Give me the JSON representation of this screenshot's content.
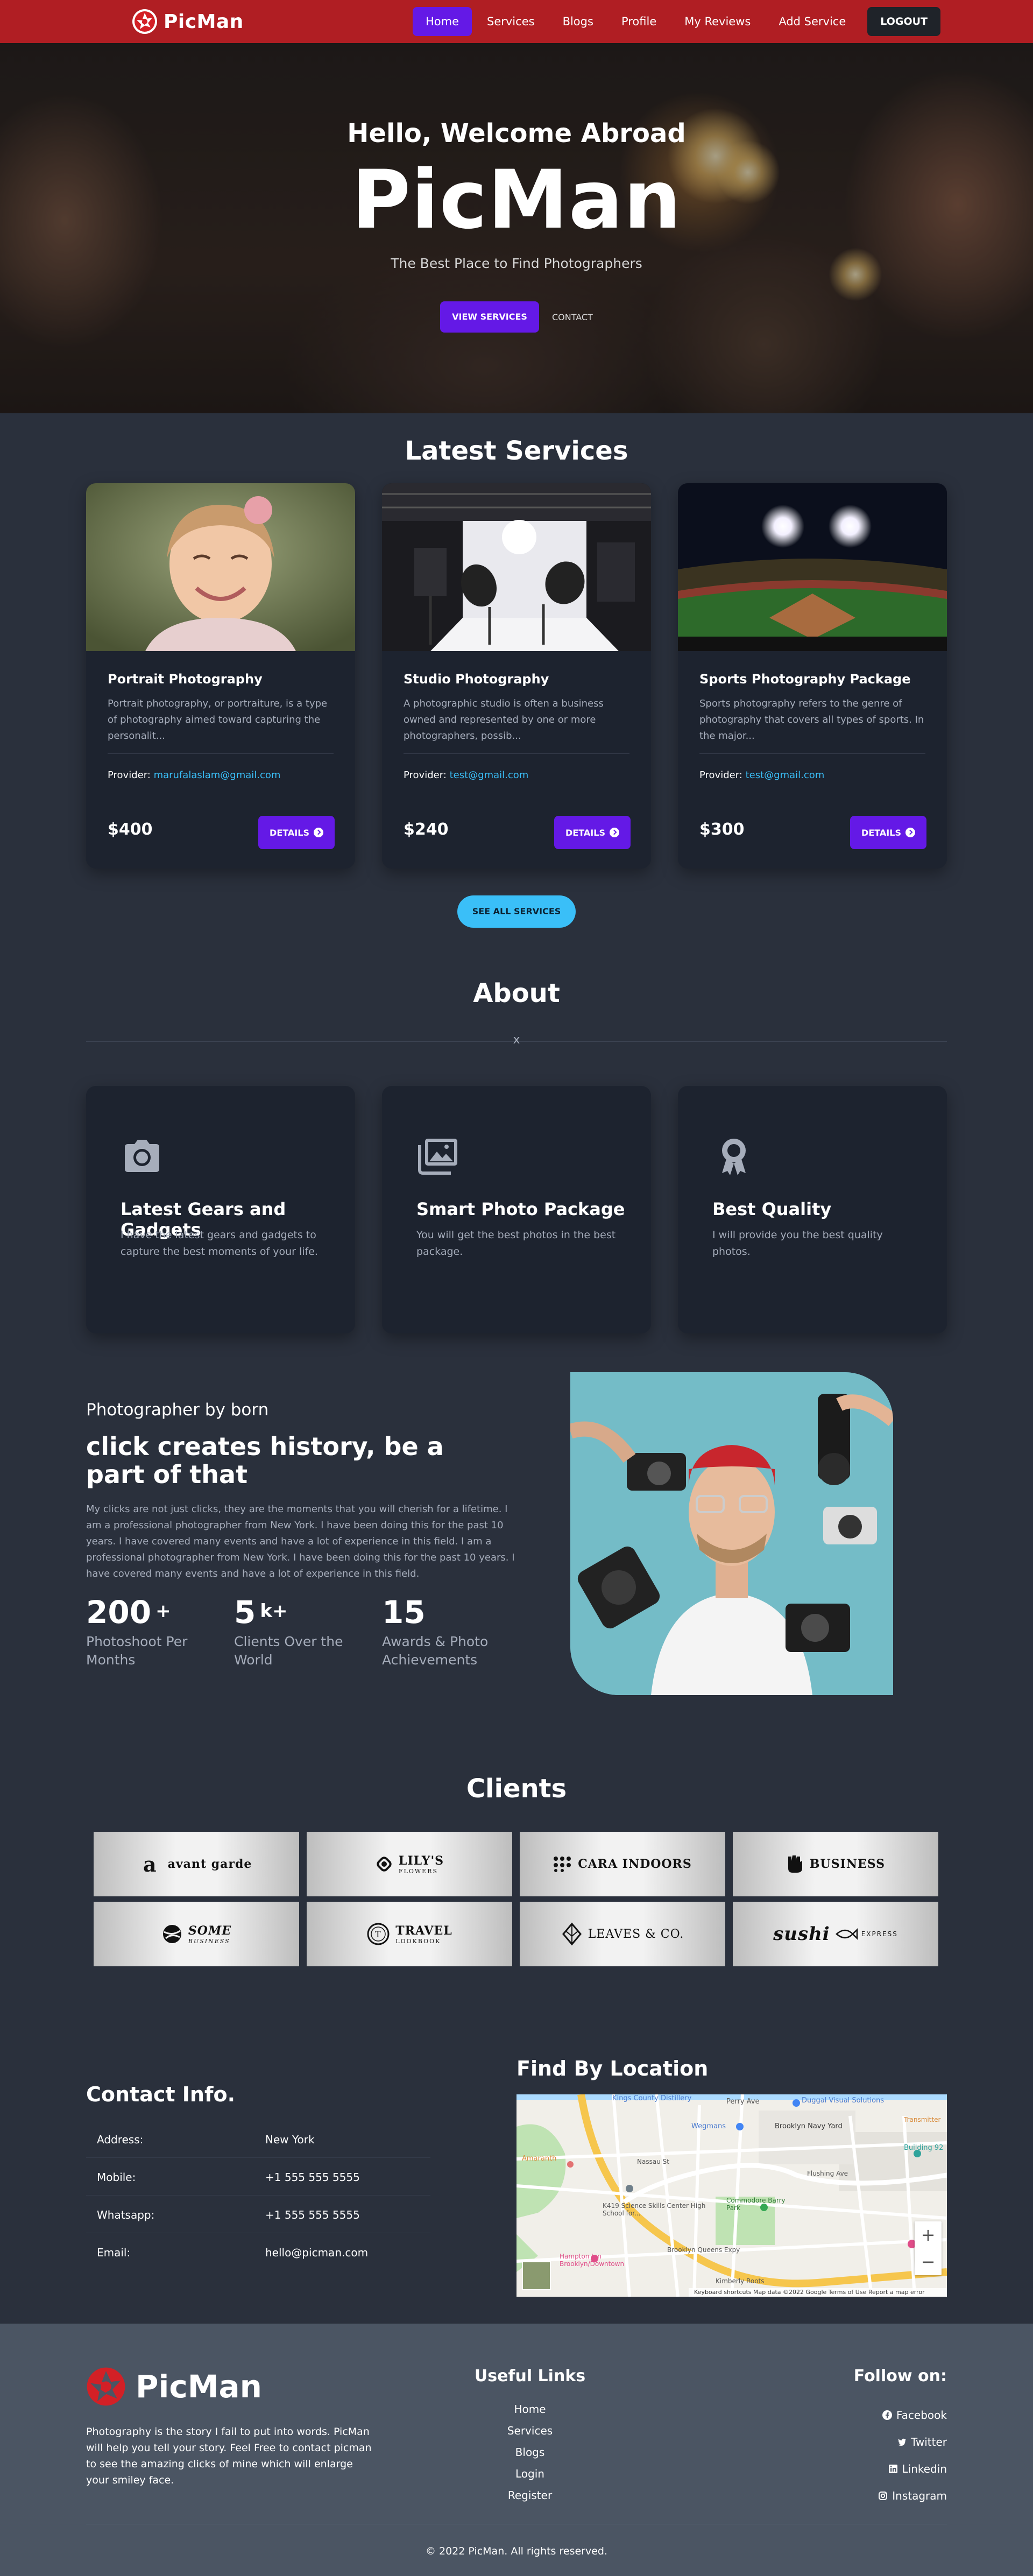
{
  "nav": {
    "brand": "PicMan",
    "items": [
      "Home",
      "Services",
      "Blogs",
      "Profile",
      "My Reviews",
      "Add Service"
    ],
    "logout": "LOGOUT"
  },
  "hero": {
    "welcome": "Hello, Welcome Abroad",
    "title": "PicMan",
    "subtitle": "The Best Place to Find Photographers",
    "btn_services": "VIEW SERVICES",
    "btn_contact": "CONTACT"
  },
  "services": {
    "title": "Latest Services",
    "provider_label": "Provider:",
    "details_label": "DETAILS",
    "see_all": "SEE ALL SERVICES",
    "cards": [
      {
        "title": "Portrait Photography",
        "desc": "Portrait photography, or portraiture, is a type of photography aimed toward capturing the personalit...",
        "email": "marufalaslam@gmail.com",
        "price": "$400"
      },
      {
        "title": "Studio Photography",
        "desc": "A photographic studio is often a business owned and represented by one or more photographers, possib...",
        "email": "test@gmail.com",
        "price": "$240"
      },
      {
        "title": "Sports Photography Package",
        "desc": "Sports photography refers to the genre of photography that covers all types of sports. In the major...",
        "email": "test@gmail.com",
        "price": "$300"
      }
    ]
  },
  "about": {
    "title": "About",
    "divider_mark": "x",
    "cards": [
      {
        "icon": "camera-icon",
        "title": "Latest Gears and Gadgets",
        "desc": "I have the latest gears and gadgets to capture the best moments of your life."
      },
      {
        "icon": "photos-icon",
        "title": "Smart Photo Package",
        "desc": "You will get the best photos in the best package."
      },
      {
        "icon": "award-icon",
        "title": "Best Quality",
        "desc": "I will provide you the best quality photos."
      }
    ]
  },
  "photographer": {
    "small": "Photographer by born",
    "heading": "click creates history, be a part of that",
    "text": "My clicks are not just clicks, they are the moments that you will cherish for a lifetime. I am a professional photographer from New York. I have been doing this for the past 10 years. I have covered many events and have a lot of experience in this field. I am a professional photographer from New York. I have been doing this for the past 10 years. I have covered many events and have a lot of experience in this field.",
    "stats": [
      {
        "num": "200",
        "suffix": "+",
        "label": "Photoshoot Per Months"
      },
      {
        "num": "5",
        "suffix": "k+",
        "label": "Clients Over the World"
      },
      {
        "num": "15",
        "suffix": "",
        "label": "Awards & Photo Achievements"
      }
    ]
  },
  "clients": {
    "title": "Clients",
    "logos": [
      {
        "name": "avant garde",
        "sub": ""
      },
      {
        "name": "LILY'S",
        "sub": "FLOWERS"
      },
      {
        "name": "CARA INDOORS",
        "sub": ""
      },
      {
        "name": "BUSINESS",
        "sub": ""
      },
      {
        "name": "SOME",
        "sub": "BUSINESS"
      },
      {
        "name": "TRAVEL",
        "sub": "LOOKBOOK"
      },
      {
        "name": "LEAVES & CO.",
        "sub": ""
      },
      {
        "name": "sushi",
        "sub": "EXPRESS"
      }
    ]
  },
  "contact": {
    "title": "Contact Info.",
    "rows": [
      {
        "k": "Address:",
        "v": "New York"
      },
      {
        "k": "Mobile:",
        "v": "+1 555 555 5555"
      },
      {
        "k": "Whatsapp:",
        "v": "+1 555 555 5555"
      },
      {
        "k": "Email:",
        "v": "hello@picman.com"
      }
    ]
  },
  "location": {
    "title": "Find By Location",
    "labels": [
      "Kings County Distillery",
      "Perry Ave",
      "Duggal Visual Solutions",
      "Wegmans",
      "Brooklyn Navy Yard",
      "Building 92",
      "Amaranth",
      "Nassau St",
      "Flushing Ave",
      "K419 Science Skills Center High School for...",
      "Commodore Barry Park",
      "Hampton Inn Brooklyn/Downtown",
      "Brooklyn Queens Expy",
      "Kimberly Roots",
      "Transmitter"
    ],
    "zoom_in": "+",
    "zoom_out": "−",
    "footer": "Keyboard shortcuts   Map data ©2022 Google   Terms of Use   Report a map error"
  },
  "footer": {
    "brand": "PicMan",
    "desc": "Photography is the story I fail to put into words. PicMan will help you tell your story. Feel Free to contact picman to see the amazing clicks of mine which will enlarge your smiley face.",
    "links_title": "Useful Links",
    "links": [
      "Home",
      "Services",
      "Blogs",
      "Login",
      "Register"
    ],
    "follow_title": "Follow on:",
    "socials": [
      {
        "icon": "facebook-icon",
        "label": "Facebook"
      },
      {
        "icon": "twitter-icon",
        "label": "Twitter"
      },
      {
        "icon": "linkedin-icon",
        "label": "Linkedin"
      },
      {
        "icon": "instagram-icon",
        "label": "Instagram"
      }
    ],
    "copyright": "© 2022 PicMan. All rights reserved."
  },
  "colors": {
    "nav": "#b01e23",
    "primary": "#6419e6",
    "accent": "#3abff8",
    "bg": "#2a303c",
    "card": "#1d232f",
    "footer": "#4b5563"
  }
}
